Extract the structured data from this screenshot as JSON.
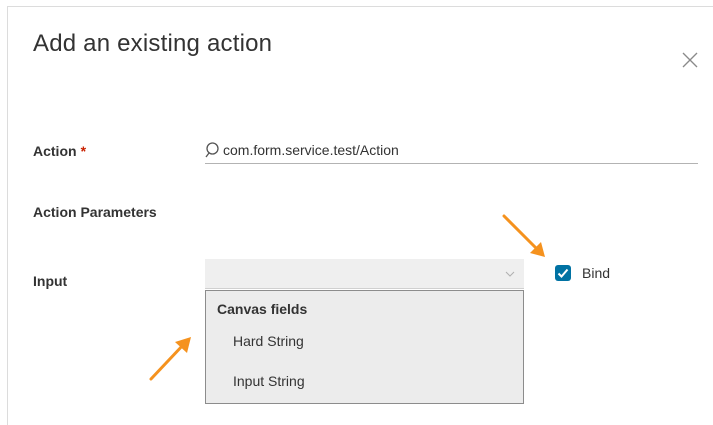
{
  "dialog": {
    "title": "Add an existing action",
    "close_icon": "close-icon"
  },
  "form": {
    "action_label": "Action",
    "required_marker": "*",
    "action_value": "com.form.service.test/Action",
    "params_label": "Action Parameters",
    "input_label": "Input",
    "input_value": "",
    "bind_label": "Bind",
    "bind_checked": true
  },
  "dropdown": {
    "group_header": "Canvas fields",
    "options": [
      {
        "label": "Hard String"
      },
      {
        "label": "Input String"
      }
    ]
  },
  "colors": {
    "accent": "#0072a3",
    "required": "#c92100",
    "annotation_arrow": "#f5921e"
  }
}
